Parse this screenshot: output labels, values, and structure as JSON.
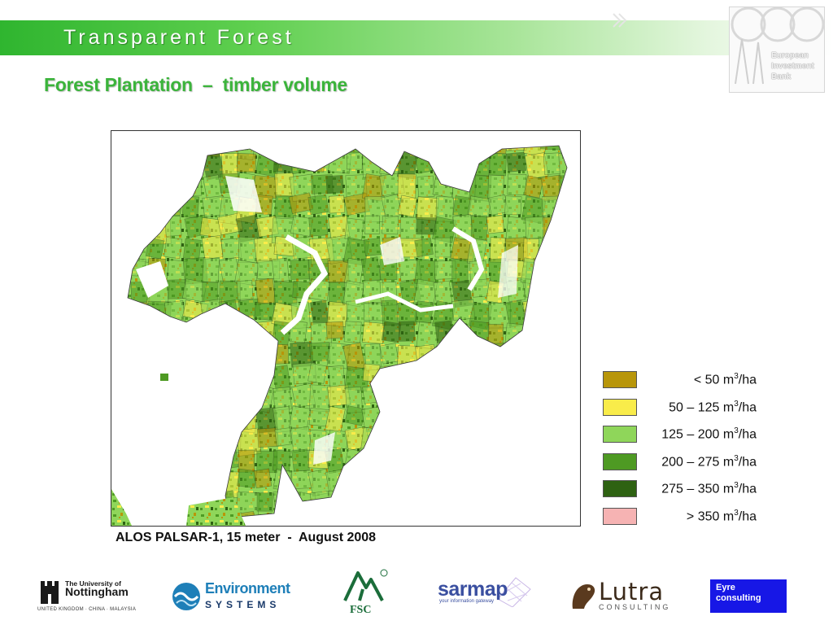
{
  "banner": {
    "title": "Transparent  Forest"
  },
  "eib_logo": {
    "text": "European\nInvestment\nBank"
  },
  "slide": {
    "title": "Forest Plantation  –  timber volume"
  },
  "map": {
    "caption": "ALOS PALSAR-1, 15 meter  -  August 2008"
  },
  "legend": [
    {
      "label": "< 50 m³/ha",
      "color": "#b8960a"
    },
    {
      "label": "50 – 125 m³/ha",
      "color": "#f9ec4a"
    },
    {
      "label": "125 – 200 m³/ha",
      "color": "#8fd65a"
    },
    {
      "label": "200 – 275 m³/ha",
      "color": "#4e9a23"
    },
    {
      "label": "275 – 350 m³/ha",
      "color": "#2e6212"
    },
    {
      "label": "> 350 m³/ha",
      "color": "#f6b3b3"
    }
  ],
  "logos": {
    "nottingham": {
      "line1": "The University of",
      "line2": "Nottingham",
      "sub": "UNITED KINGDOM · CHINA · MALAYSIA"
    },
    "environment_systems": {
      "line1": "Environment",
      "line2": "SYSTEMS"
    },
    "fsc": {
      "text": "FSC"
    },
    "sarmap": {
      "name": "sarmap",
      "tagline": "your information gateway"
    },
    "lutra": {
      "name": "Lutra",
      "sub": "CONSULTING"
    },
    "eyre": {
      "text": "Eyre\nconsulting"
    }
  }
}
